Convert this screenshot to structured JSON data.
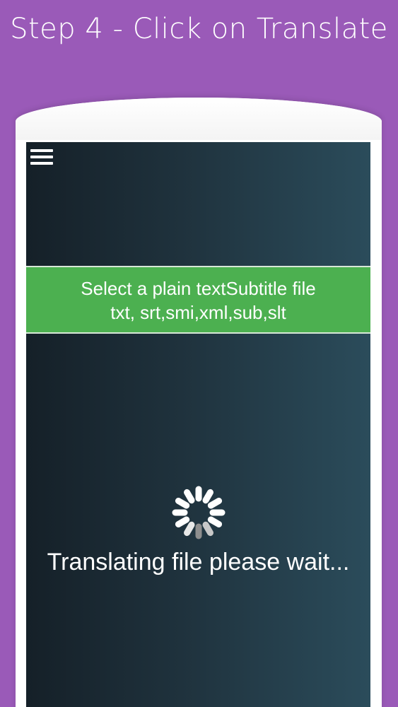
{
  "promo": {
    "title": "Step 4 - Click on Translate"
  },
  "app": {
    "menu_icon": "hamburger-menu-icon",
    "file_select": {
      "line1": "Select a plain textSubtitle file",
      "line2": "txt, srt,smi,xml,sub,slt",
      "color": "#4cb050"
    },
    "loading": {
      "spinner_icon": "loading-spinner-icon",
      "text": "Translating file please wait..."
    }
  },
  "colors": {
    "background": "#9a5ab8",
    "screen_dark": "#152028",
    "screen_light": "#2b4c5b",
    "accent_green": "#4cb050"
  }
}
